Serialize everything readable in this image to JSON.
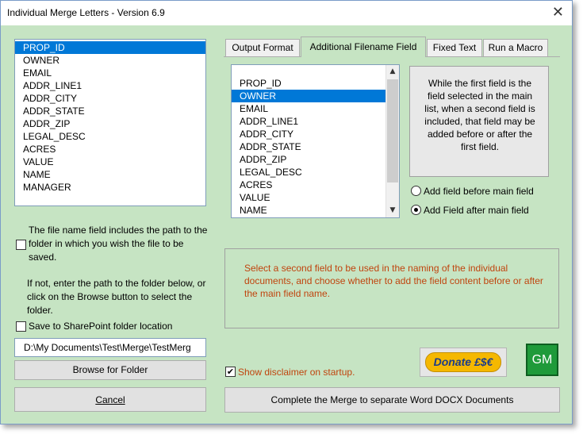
{
  "window": {
    "title": "Individual Merge Letters - Version 6.9",
    "close_glyph": "✕"
  },
  "main_fields": {
    "items": [
      "PROP_ID",
      "OWNER",
      "EMAIL",
      "ADDR_LINE1",
      "ADDR_CITY",
      "ADDR_STATE",
      "ADDR_ZIP",
      "LEGAL_DESC",
      "ACRES",
      "VALUE",
      "NAME",
      "MANAGER"
    ],
    "selected": "PROP_ID"
  },
  "path_option": {
    "checkbox_label": "The file name field includes the path to the folder in which you wish the file to be saved.",
    "checked": false,
    "hint": "If not, enter the path to the folder below, or click on the Browse button to select the folder."
  },
  "sharepoint": {
    "label": "Save to SharePoint folder location",
    "checked": false
  },
  "folder_path": {
    "value": "D:\\My Documents\\Test\\Merge\\TestMerg"
  },
  "buttons": {
    "browse": "Browse for Folder",
    "cancel": "Cancel",
    "complete": "Complete the Merge to separate Word DOCX Documents",
    "donate": "Donate £$€",
    "gm": "GM"
  },
  "tabs": [
    "Output Format",
    "Additional Filename Field",
    "Fixed Text",
    "Run a Macro"
  ],
  "active_tab": "Additional Filename Field",
  "second_fields": {
    "items": [
      "PROP_ID",
      "OWNER",
      "EMAIL",
      "ADDR_LINE1",
      "ADDR_CITY",
      "ADDR_STATE",
      "ADDR_ZIP",
      "LEGAL_DESC",
      "ACRES",
      "VALUE",
      "NAME"
    ],
    "selected": "OWNER"
  },
  "info_text": "While the first field is the field selected in the main list, when a second field is included, that field may be added before or after the first field.",
  "position_options": {
    "before": "Add field before main field",
    "after": "Add Field after main field",
    "selected": "after"
  },
  "message": "Select a second field to be used in the naming of the individual documents, and choose whether to add the field content before or after the main field name.",
  "disclaimer": {
    "label": "Show disclaimer on startup.",
    "checked": true
  },
  "colors": {
    "background": "#c6e4c3",
    "selection": "#0078d7",
    "message_text": "#c0440e",
    "donate_bg": "#f5b800",
    "gm_bg": "#1f9a3a"
  }
}
